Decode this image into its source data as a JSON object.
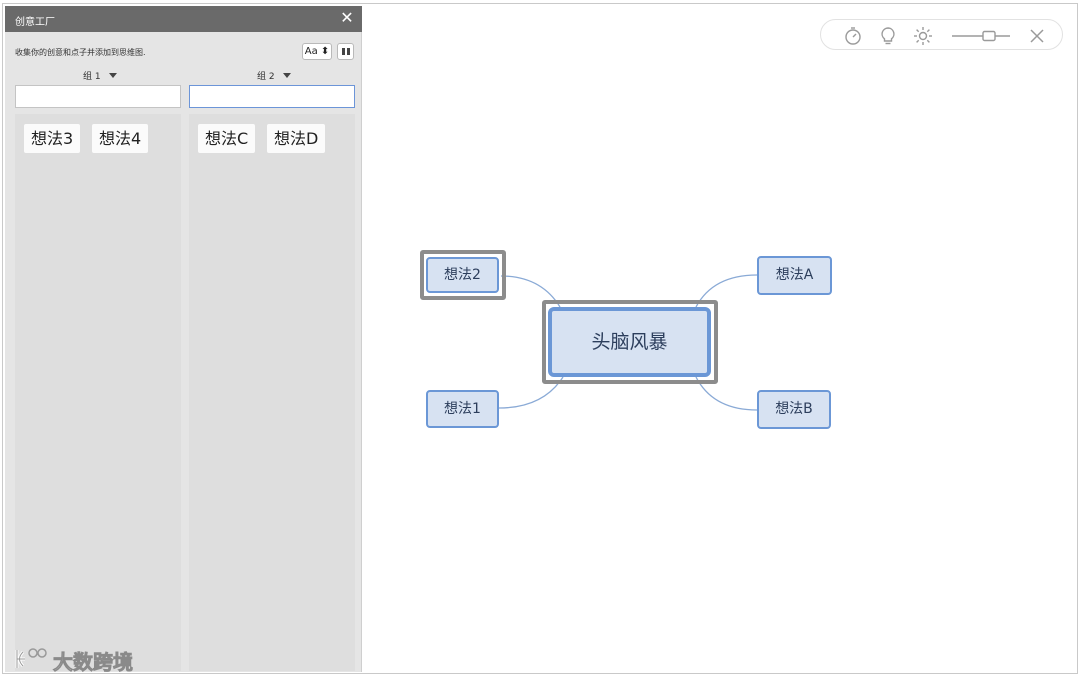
{
  "panel": {
    "title": "创意工厂",
    "close_icon": "close-icon",
    "hint": "收集你的创意和点子并添加到思维图.",
    "font_button_label": "Aa ⬍",
    "groups": [
      {
        "title": "组 1",
        "input_value": "",
        "ideas": [
          "想法3",
          "想法4"
        ]
      },
      {
        "title": "组 2",
        "input_value": "",
        "ideas": [
          "想法C",
          "想法D"
        ]
      }
    ]
  },
  "toolbar": {
    "icons": [
      "timer-icon",
      "lightbulb-icon",
      "brightness-icon",
      "zoom-slider-icon",
      "close-icon"
    ]
  },
  "mindmap": {
    "central": "头脑风暴",
    "left_topics": [
      "想法2",
      "想法1"
    ],
    "right_topics": [
      "想法A",
      "想法B"
    ],
    "selected_topics": [
      "头脑风暴",
      "想法2"
    ],
    "colors": {
      "node_fill": "#d7e2f2",
      "node_border": "#6b97d6",
      "link": "#8aaad6",
      "selection": "#8c8c8c"
    }
  },
  "watermark": {
    "text": "大数跨境"
  }
}
